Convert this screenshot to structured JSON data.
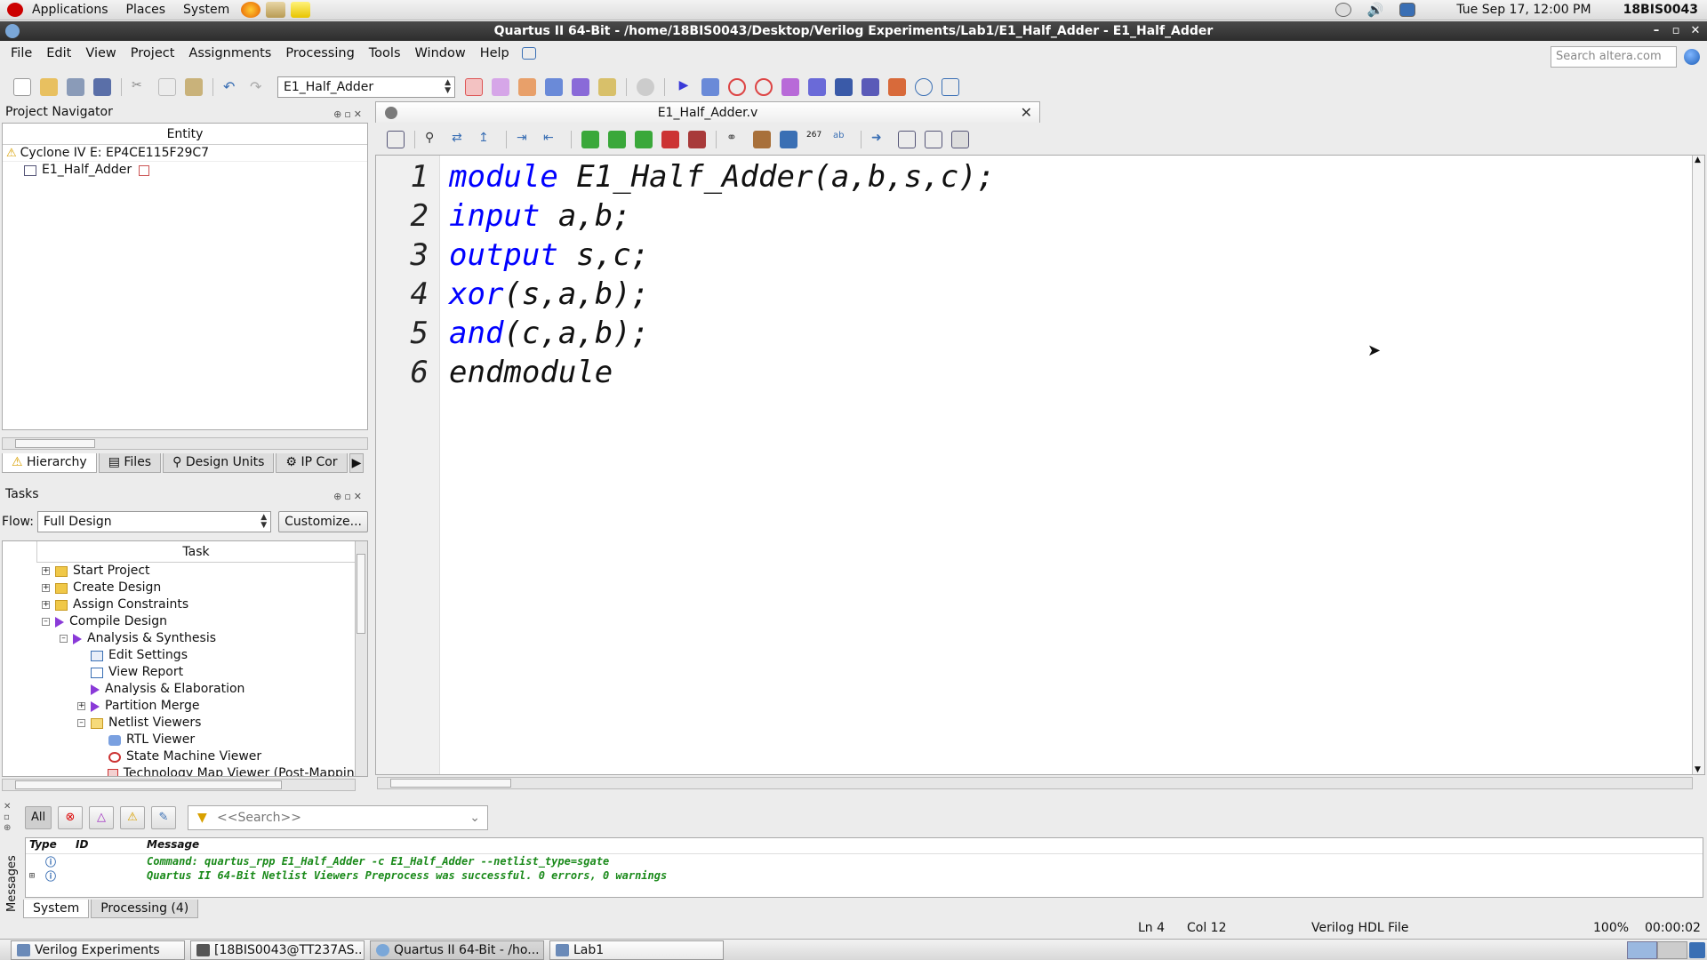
{
  "gnome_panel": {
    "menus": [
      "Applications",
      "Places",
      "System"
    ],
    "datetime": "Tue Sep 17, 12:00 PM",
    "user": "18BIS0043"
  },
  "window": {
    "title": "Quartus II 64-Bit - /home/18BIS0043/Desktop/Verilog Experiments/Lab1/E1_Half_Adder - E1_Half_Adder",
    "controls": [
      "–",
      "▫",
      "✕"
    ]
  },
  "menubar": {
    "items": [
      "File",
      "Edit",
      "View",
      "Project",
      "Assignments",
      "Processing",
      "Tools",
      "Window",
      "Help"
    ],
    "search_placeholder": "Search altera.com"
  },
  "toolbar": {
    "entity_value": "E1_Half_Adder"
  },
  "project_navigator": {
    "title": "Project Navigator",
    "column_header": "Entity",
    "device": "Cyclone IV E: EP4CE115F29C7",
    "top_entity": "E1_Half_Adder",
    "tabs": [
      "Hierarchy",
      "Files",
      "Design Units",
      "IP Cor"
    ]
  },
  "tasks": {
    "title": "Tasks",
    "flow_label": "Flow:",
    "flow_value": "Full Design",
    "customize_label": "Customize...",
    "column_header": "Task",
    "items": [
      {
        "label": "Start Project",
        "indent": 0,
        "expander": "+",
        "icon": "folder"
      },
      {
        "label": "Create Design",
        "indent": 0,
        "expander": "+",
        "icon": "folder"
      },
      {
        "label": "Assign Constraints",
        "indent": 0,
        "expander": "+",
        "icon": "folder"
      },
      {
        "label": "Compile Design",
        "indent": 0,
        "expander": "–",
        "icon": "play"
      },
      {
        "label": "Analysis & Synthesis",
        "indent": 1,
        "expander": "–",
        "icon": "play"
      },
      {
        "label": "Edit Settings",
        "indent": 2,
        "expander": "",
        "icon": "settings"
      },
      {
        "label": "View Report",
        "indent": 2,
        "expander": "",
        "icon": "report"
      },
      {
        "label": "Analysis & Elaboration",
        "indent": 2,
        "expander": "",
        "icon": "play"
      },
      {
        "label": "Partition Merge",
        "indent": 2,
        "expander": "+",
        "icon": "play"
      },
      {
        "label": "Netlist Viewers",
        "indent": 2,
        "expander": "–",
        "icon": "folder-open"
      },
      {
        "label": "RTL Viewer",
        "indent": 3,
        "expander": "",
        "icon": "rtl"
      },
      {
        "label": "State Machine Viewer",
        "indent": 3,
        "expander": "",
        "icon": "fsm"
      },
      {
        "label": "Technology Map Viewer (Post-Mapping)",
        "indent": 3,
        "expander": "",
        "icon": "techmap"
      }
    ]
  },
  "editor": {
    "tab_title": "E1_Half_Adder.v",
    "lines": [
      {
        "no": "1",
        "kw": "module",
        "rest": " E1_Half_Adder(a,b,s,c);"
      },
      {
        "no": "2",
        "kw": "input",
        "rest": " a,b;"
      },
      {
        "no": "3",
        "kw": "output",
        "rest": " s,c;"
      },
      {
        "no": "4",
        "kw": "xor",
        "rest": "(s,a,b);"
      },
      {
        "no": "5",
        "kw": "and",
        "rest": "(c,a,b);"
      },
      {
        "no": "6",
        "kw": "",
        "rest": "endmodule"
      }
    ]
  },
  "messages": {
    "side_label": "Messages",
    "filter_all": "All",
    "search_placeholder": "<<Search>>",
    "columns": [
      "Type",
      "ID",
      "Message"
    ],
    "rows": [
      {
        "text": "Command: quartus_rpp E1_Half_Adder -c E1_Half_Adder --netlist_type=sgate"
      },
      {
        "text": "Quartus II 64-Bit Netlist Viewers Preprocess was successful. 0 errors, 0 warnings"
      }
    ],
    "tabs": [
      "System",
      "Processing (4)"
    ]
  },
  "statusbar": {
    "line": "Ln 4",
    "col": "Col 12",
    "filetype": "Verilog HDL File",
    "zoom": "100%",
    "elapsed": "00:00:02"
  },
  "taskbar": {
    "items": [
      {
        "label": "Verilog Experiments"
      },
      {
        "label": "[18BIS0043@TT237AS..."
      },
      {
        "label": "Quartus II 64-Bit - /ho..."
      },
      {
        "label": "Lab1"
      }
    ]
  },
  "colors": {
    "keyword": "#0000ff",
    "success_message": "#1a8a1a"
  }
}
